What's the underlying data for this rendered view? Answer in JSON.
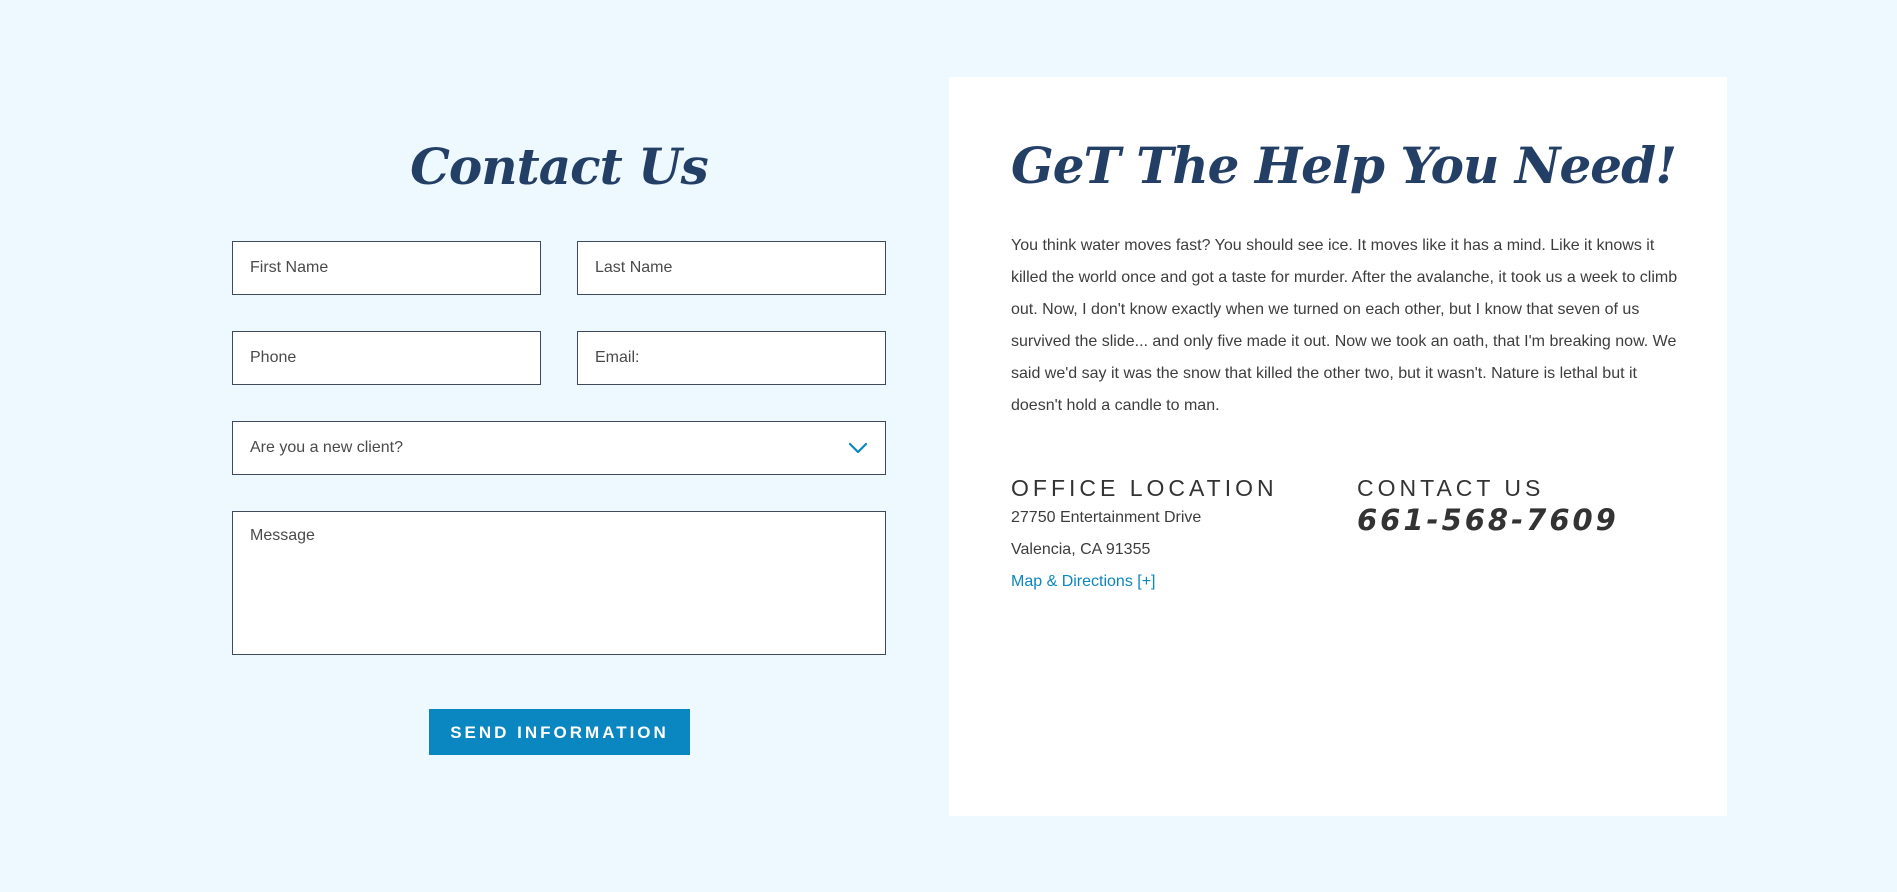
{
  "form": {
    "title": "Contact Us",
    "first_name_placeholder": "First Name",
    "last_name_placeholder": "Last Name",
    "phone_placeholder": "Phone",
    "email_placeholder": "Email:",
    "new_client_select_value": "Are you a new client?",
    "message_placeholder": "Message",
    "submit_label": "SEND INFORMATION"
  },
  "info": {
    "title": "GeT The Help You Need!",
    "body": "You think water moves fast? You should see ice. It moves like it has a mind. Like it knows it killed the world once and got a taste for murder. After the avalanche, it took us a week to climb out. Now, I don't know exactly when we turned on each other, but I know that seven of us survived the slide... and only five made it out. Now we took an oath, that I'm breaking now. We said we'd say it was the snow that killed the other two, but it wasn't. Nature is lethal but it doesn't hold a candle to man.",
    "office": {
      "heading": "OFFICE LOCATION",
      "address_line_1": "27750 Entertainment Drive",
      "address_line_2": "Valencia, CA 91355",
      "map_link": "Map & Directions [+]"
    },
    "contact": {
      "heading": "CONTACT US",
      "phone": "661-568-7609"
    }
  },
  "icons": {
    "select_chevron": "chevron-down-icon"
  },
  "colors": {
    "page_background": "#edf9fe",
    "heading_navy": "#233f66",
    "accent_blue": "#0a86c0",
    "card_background": "#ffffff",
    "field_border": "#3d4a5c"
  }
}
